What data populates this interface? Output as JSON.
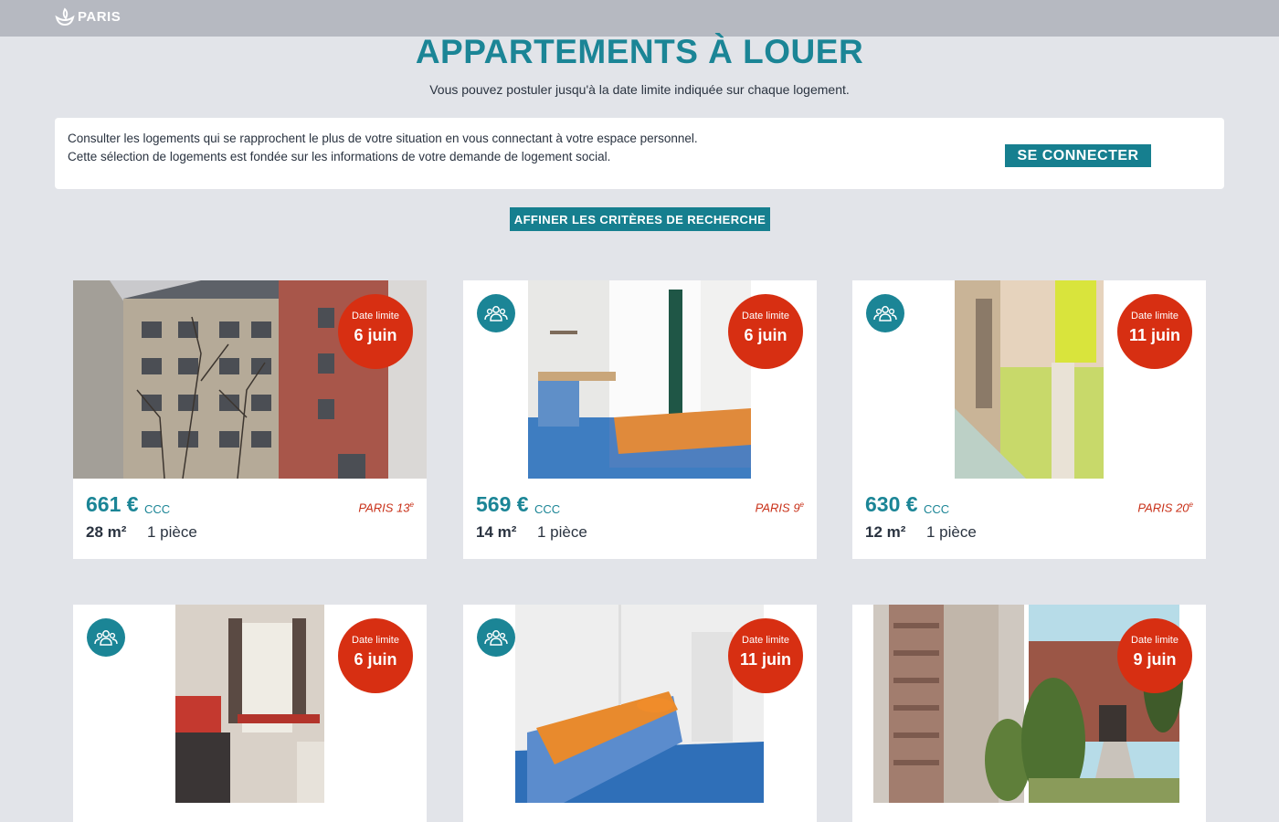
{
  "header": {
    "logo_text": "PARIS",
    "logo_icon": "paris-boat-icon"
  },
  "page": {
    "title_strong": "APPARTEMENTS",
    "title_rest": " À LOUER",
    "subtitle": "Vous pouvez postuler jusqu'à la date limite indiquée sur chaque logement."
  },
  "info": {
    "line1": "Consulter les logements qui se rapprochent le plus de votre situation en vous connectant à votre espace personnel.",
    "line2": "Cette sélection de logements est fondée sur les informations de votre demande de logement social.",
    "connect_label": "SE CONNECTER"
  },
  "filters": {
    "refine_label": "AFFINER LES CRITÈRES DE RECHERCHE"
  },
  "colors": {
    "accent": "#1b8596",
    "button": "#167f8f",
    "deadline": "#d72f12",
    "district": "#c9321a",
    "background": "#e2e4e9",
    "topbar": "#b6b9c1"
  },
  "listings": [
    {
      "deadline_label": "Date limite",
      "deadline_date": "6 juin",
      "price": "661 €",
      "charges": "CCC",
      "district": "PARIS 13",
      "district_suffix": "e",
      "surface": "28 m²",
      "rooms": "1 pièce",
      "shared": false,
      "photo": "building-facade"
    },
    {
      "deadline_label": "Date limite",
      "deadline_date": "6 juin",
      "price": "569 €",
      "charges": "CCC",
      "district": "PARIS 9",
      "district_suffix": "e",
      "surface": "14 m²",
      "rooms": "1 pièce",
      "shared": true,
      "photo": "bedroom-blue-floor"
    },
    {
      "deadline_label": "Date limite",
      "deadline_date": "11 juin",
      "price": "630 €",
      "charges": "CCC",
      "district": "PARIS 20",
      "district_suffix": "e",
      "surface": "12 m²",
      "rooms": "1 pièce",
      "shared": true,
      "photo": "room-green-wall"
    },
    {
      "deadline_label": "Date limite",
      "deadline_date": "6 juin",
      "shared": true,
      "photo": "room-red-desk"
    },
    {
      "deadline_label": "Date limite",
      "deadline_date": "11 juin",
      "shared": true,
      "photo": "bedroom-orange-bed"
    },
    {
      "deadline_label": "Date limite",
      "deadline_date": "9 juin",
      "shared": false,
      "photo": "tower-and-garden"
    }
  ],
  "shared_icon": "group-icon"
}
